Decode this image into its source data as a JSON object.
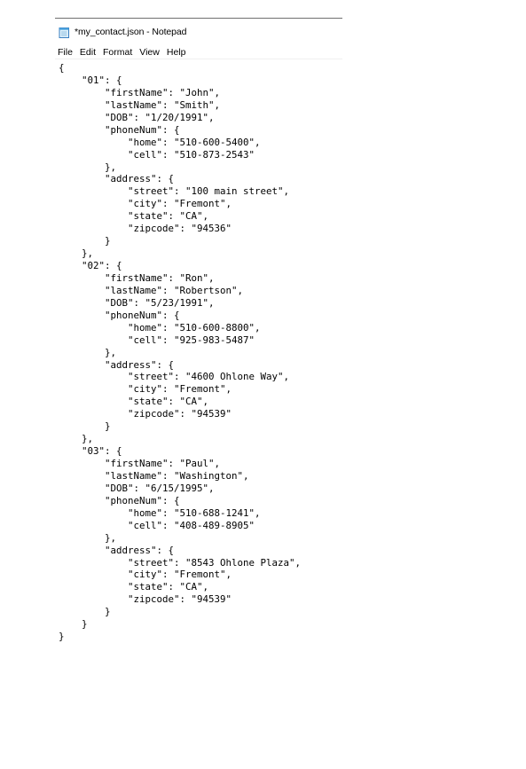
{
  "window": {
    "title": "*my_contact.json - Notepad",
    "icon": "notepad-icon"
  },
  "menu": [
    {
      "id": "file",
      "label": "File"
    },
    {
      "id": "edit",
      "label": "Edit"
    },
    {
      "id": "format",
      "label": "Format"
    },
    {
      "id": "view",
      "label": "View"
    },
    {
      "id": "help",
      "label": "Help"
    }
  ],
  "editor": {
    "lines": [
      "{",
      "    \"01\": {",
      "        \"firstName\": \"John\",",
      "        \"lastName\": \"Smith\",",
      "        \"DOB\": \"1/20/1991\",",
      "        \"phoneNum\": {",
      "            \"home\": \"510-600-5400\",",
      "            \"cell\": \"510-873-2543\"",
      "        },",
      "        \"address\": {",
      "            \"street\": \"100 main street\",",
      "            \"city\": \"Fremont\",",
      "            \"state\": \"CA\",",
      "            \"zipcode\": \"94536\"",
      "        }",
      "    },",
      "    \"02\": {",
      "        \"firstName\": \"Ron\",",
      "        \"lastName\": \"Robertson\",",
      "        \"DOB\": \"5/23/1991\",",
      "        \"phoneNum\": {",
      "            \"home\": \"510-600-8800\",",
      "            \"cell\": \"925-983-5487\"",
      "        },",
      "        \"address\": {",
      "            \"street\": \"4600 Ohlone Way\",",
      "            \"city\": \"Fremont\",",
      "            \"state\": \"CA\",",
      "            \"zipcode\": \"94539\"",
      "        }",
      "    },",
      "    \"03\": {",
      "        \"firstName\": \"Paul\",",
      "        \"lastName\": \"Washington\",",
      "        \"DOB\": \"6/15/1995\",",
      "        \"phoneNum\": {",
      "            \"home\": \"510-688-1241\",",
      "            \"cell\": \"408-489-8905\"",
      "        },",
      "        \"address\": {",
      "            \"street\": \"8543 Ohlone Plaza\",",
      "            \"city\": \"Fremont\",",
      "            \"state\": \"CA\",",
      "            \"zipcode\": \"94539\"",
      "        }",
      "    }",
      "}"
    ]
  }
}
